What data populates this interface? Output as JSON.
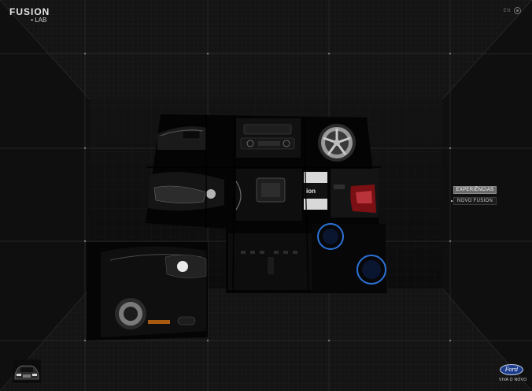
{
  "header": {
    "logo_main": "FUSION",
    "logo_sub": "• LAB",
    "language": "EN"
  },
  "menu": {
    "items": [
      {
        "label": "EXPERIÊNCIAS"
      },
      {
        "label": "NOVO FUSION"
      }
    ]
  },
  "collage": {
    "tiles": [
      {
        "subject": "car-side-silhouette"
      },
      {
        "subject": "dashboard-stereo"
      },
      {
        "subject": "alloy-wheel"
      },
      {
        "subject": "headlight-closeup"
      },
      {
        "subject": "center-console"
      },
      {
        "subject": "fusion-badge"
      },
      {
        "subject": "taillight"
      },
      {
        "subject": "front-three-quarter"
      },
      {
        "subject": "console-vents"
      },
      {
        "subject": "blue-cupholders"
      }
    ]
  },
  "footer": {
    "brand": "Ford",
    "slogan": "VIVA O NOVO"
  }
}
